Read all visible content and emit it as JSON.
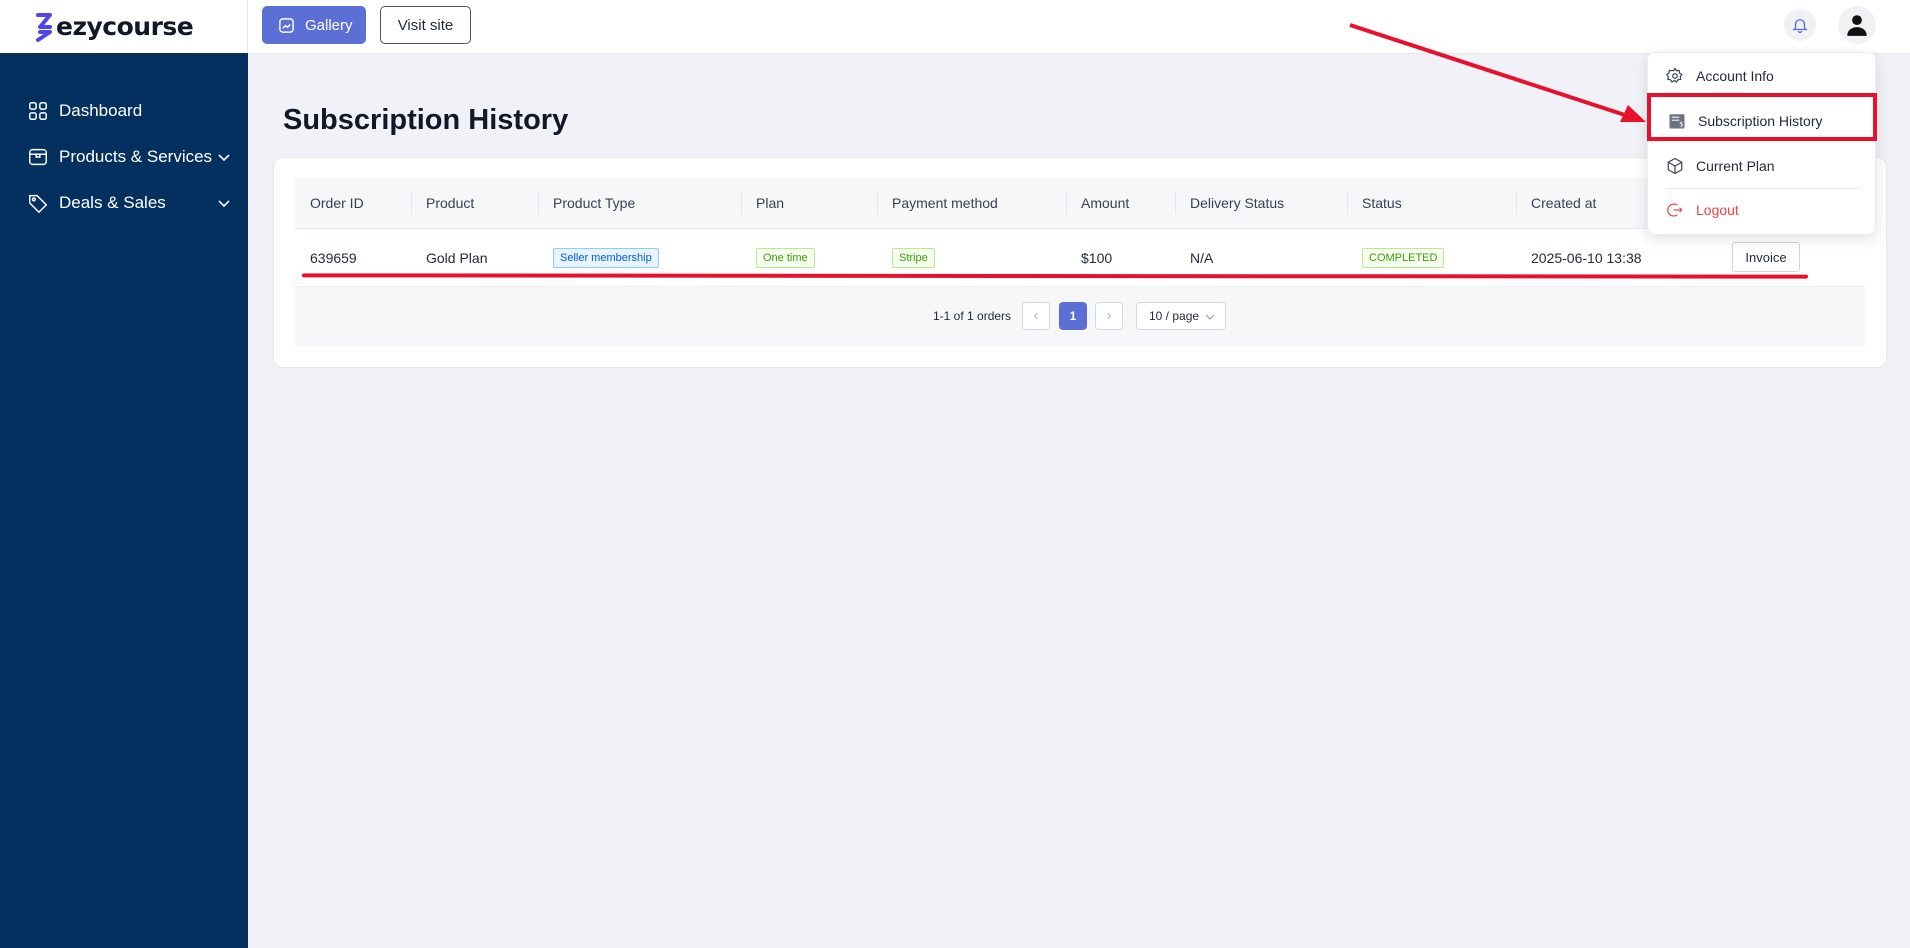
{
  "brand": {
    "name": "ezycourse",
    "accent": "#5b6fd4",
    "sidebar_bg": "#04305f"
  },
  "sidebar": {
    "items": [
      {
        "label": "Dashboard",
        "icon": "dashboard-grid-icon"
      },
      {
        "label": "Products & Services",
        "icon": "box-icon",
        "has_chevron": true
      },
      {
        "label": "Deals & Sales",
        "icon": "tag-icon",
        "has_chevron": true
      }
    ]
  },
  "topbar": {
    "gallery_label": "Gallery",
    "visit_label": "Visit site",
    "bell_icon": "bell-icon",
    "avatar_icon": "user-avatar-icon"
  },
  "main": {
    "title": "Subscription History",
    "table": {
      "headers": [
        "Order ID",
        "Product",
        "Product Type",
        "Plan",
        "Payment method",
        "Amount",
        "Delivery Status",
        "Status",
        "Created at"
      ],
      "rows": [
        {
          "order_id": "639659",
          "product": "Gold Plan",
          "product_type": "Seller membership",
          "plan": "One time",
          "payment_method": "Stripe",
          "amount": "$100",
          "delivery_status": "N/A",
          "status": "COMPLETED",
          "created_at": "2025-06-10 13:38",
          "action_label": "Invoice"
        }
      ]
    },
    "pagination": {
      "summary": "1-1 of 1 orders",
      "current_page": "1",
      "page_size": "10 / page"
    }
  },
  "dropdown": {
    "items": [
      {
        "label": "Account Info",
        "icon": "gear-icon"
      },
      {
        "label": "Subscription History",
        "icon": "receipt-icon"
      },
      {
        "label": "Current Plan",
        "icon": "package-icon"
      },
      {
        "label": "Logout",
        "icon": "logout-icon",
        "color": "#ef4444"
      }
    ]
  },
  "annotation_color": "#e8112d"
}
